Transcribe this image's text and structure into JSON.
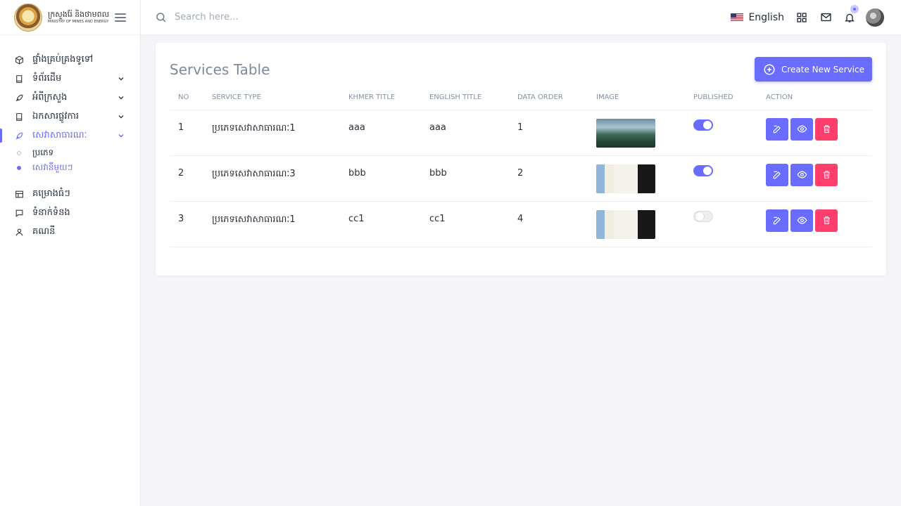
{
  "brand": {
    "title_kh": "ក្រសួងរ៉ែ និងថាមពល",
    "title_en": "MINISTRY OF MINES AND ENERGY"
  },
  "sidebar": {
    "items": [
      {
        "label": "ផ្ទាំងគ្រប់គ្រងទូទៅ",
        "icon": "cube-icon",
        "has_chevron": false
      },
      {
        "label": "ទំព័រដើម",
        "icon": "book-icon",
        "has_chevron": true
      },
      {
        "label": "អំពីក្រសួង",
        "icon": "feather-icon",
        "has_chevron": true
      },
      {
        "label": "ឯកសារផ្លូវការ",
        "icon": "book-icon",
        "has_chevron": true
      },
      {
        "label": "សេវាសាធារណៈ",
        "icon": "feather-icon",
        "has_chevron": true,
        "active": true
      }
    ],
    "subitems": [
      {
        "label": "ប្រភេទ",
        "active": false
      },
      {
        "label": "សេវានីមួយៗ",
        "active": true
      }
    ],
    "bottom_items": [
      {
        "label": "គម្រោងធំៗ",
        "icon": "table-icon"
      },
      {
        "label": "ទំនាក់ទំនង",
        "icon": "chat-icon"
      },
      {
        "label": "គណនី",
        "icon": "user-icon"
      }
    ]
  },
  "topbar": {
    "search_placeholder": "Search here...",
    "language": "English"
  },
  "card": {
    "title": "Services Table",
    "create_button": "Create New Service"
  },
  "table": {
    "headers": [
      "NO",
      "SERVICE TYPE",
      "KHMER TITLE",
      "ENGLISH TITLE",
      "DATA ORDER",
      "IMAGE",
      "PUBLISHED",
      "ACTION"
    ],
    "rows": [
      {
        "no": "1",
        "service_type": "ប្រភេទសេវាសាធារណៈ1",
        "khmer_title": "aaa",
        "english_title": "aaa",
        "data_order": "1",
        "image": "mountain",
        "published": true
      },
      {
        "no": "2",
        "service_type": "ប្រភេទសេវាសាធារណៈ3",
        "khmer_title": "bbb",
        "english_title": "bbb",
        "data_order": "2",
        "image": "document",
        "published": true
      },
      {
        "no": "3",
        "service_type": "ប្រភេទសេវាសាធារណៈ1",
        "khmer_title": "cc1",
        "english_title": "cc1",
        "data_order": "4",
        "image": "document",
        "published": false
      }
    ]
  },
  "colors": {
    "primary": "#696cff",
    "danger": "#ff3e6c",
    "background": "#f5f5f9"
  }
}
